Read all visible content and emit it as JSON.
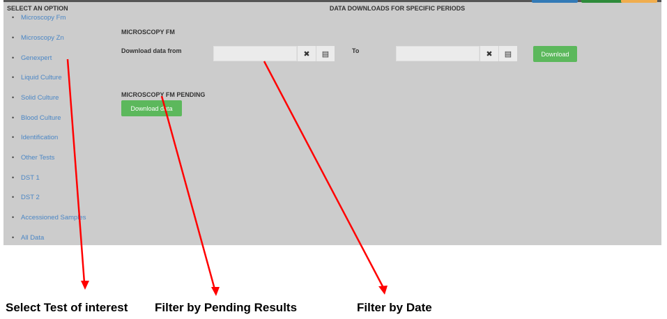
{
  "header": {
    "select_title": "SELECT AN OPTION",
    "main_title": "DATA DOWNLOADS FOR SPECIFIC PERIODS",
    "top_button_colors": [
      "#337ab7",
      "#2e8b3a",
      "#f0ad4e"
    ]
  },
  "sidebar": {
    "items": [
      {
        "label": "Microscopy Fm"
      },
      {
        "label": "Microscopy Zn"
      },
      {
        "label": "Genexpert"
      },
      {
        "label": "Liquid Culture"
      },
      {
        "label": "Solid Culture"
      },
      {
        "label": "Blood Culture"
      },
      {
        "label": "Identification"
      },
      {
        "label": "Other Tests"
      },
      {
        "label": "DST 1"
      },
      {
        "label": "DST 2"
      },
      {
        "label": "Accessioned Samples"
      },
      {
        "label": "All Data"
      }
    ],
    "link_color": "#4a86c5"
  },
  "main": {
    "section1_title": "MICROSCOPY FM",
    "download_from_label": "Download data from",
    "to_label": "To",
    "from_value": "",
    "to_value": "",
    "clear_icon": "close-icon",
    "calendar_icon": "calendar-icon",
    "download_button": "Download",
    "section2_title": "MICROSCOPY FM PENDING",
    "download_data_button": "Download data",
    "button_color": "#5cb85c"
  },
  "annotations": {
    "caption1": "Select Test of interest",
    "caption2": "Filter by Pending Results",
    "caption3": "Filter by Date",
    "arrow_color": "#ff0000"
  }
}
